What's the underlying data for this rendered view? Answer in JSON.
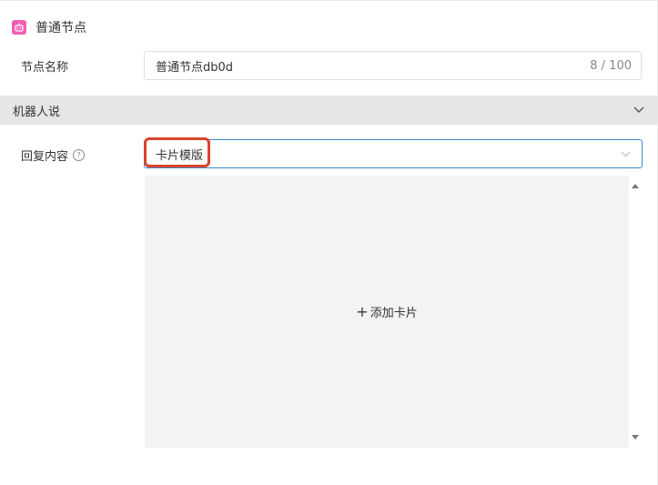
{
  "header": {
    "title": "普通节点",
    "icon": "robot-icon",
    "icon_color": "#f25fb0"
  },
  "node_name": {
    "label": "节点名称",
    "value": "普通节点db0d",
    "count": "8 / 100"
  },
  "section": {
    "title": "机器人说",
    "chevron": "chevron-down-icon"
  },
  "reply": {
    "label": "回复内容",
    "help_icon": "?",
    "template_value": "卡片模版",
    "highlight_color": "#d9452b"
  },
  "card_area": {
    "plus": "+",
    "add_label": "添加卡片"
  }
}
